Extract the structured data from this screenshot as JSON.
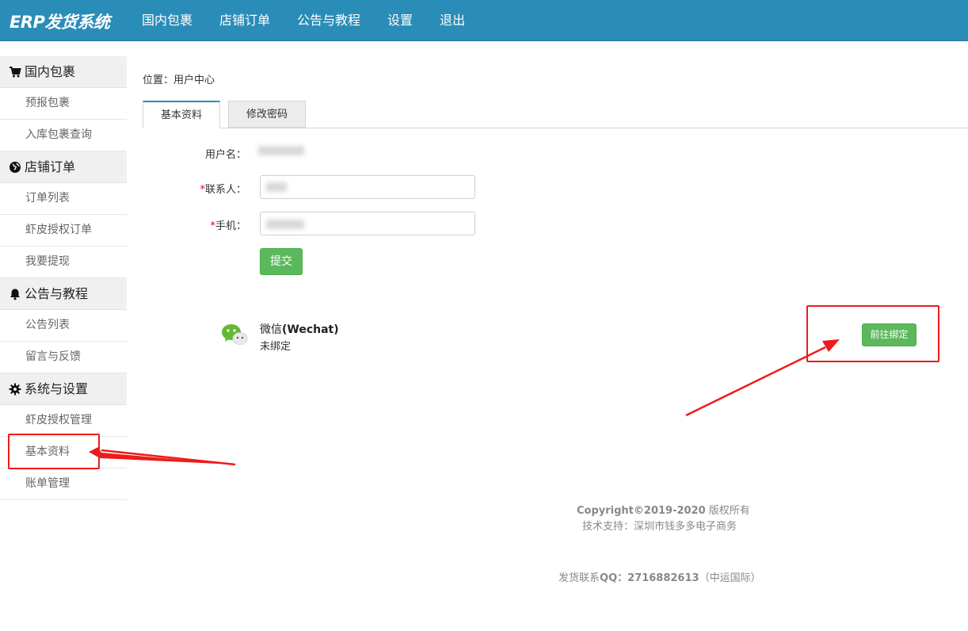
{
  "header": {
    "brand": "ERP发货系统",
    "nav": [
      "国内包裹",
      "店铺订单",
      "公告与教程",
      "设置",
      "退出"
    ]
  },
  "sidebar": {
    "groups": [
      {
        "title": "国内包裹",
        "icon": "cart-icon",
        "items": [
          "预报包裹",
          "入库包裹查询"
        ]
      },
      {
        "title": "店铺订单",
        "icon": "globe-icon",
        "items": [
          "订单列表",
          "虾皮授权订单",
          "我要提现"
        ]
      },
      {
        "title": "公告与教程",
        "icon": "bell-icon",
        "items": [
          "公告列表",
          "留言与反馈"
        ]
      },
      {
        "title": "系统与设置",
        "icon": "gear-icon",
        "items": [
          "虾皮授权管理",
          "基本资料",
          "账单管理"
        ]
      }
    ]
  },
  "breadcrumb": "位置：用户中心",
  "tabs": [
    "基本资料",
    "修改密码"
  ],
  "form": {
    "username_label": "用户名：",
    "contact_label": "联系人：",
    "phone_label": "手机：",
    "required_mark": "*",
    "submit_label": "提交"
  },
  "wechat": {
    "icon": "wechat-icon",
    "title_prefix": "微信",
    "title_bold": "(Wechat)",
    "status": "未绑定",
    "bind_label": "前往绑定"
  },
  "footer": {
    "copyright": "Copyright©2019-2020",
    "rights": " 版权所有",
    "support": "技术支持：深圳市钱多多电子商务",
    "contact_prefix": "发货联系",
    "contact_qq_label": "QQ：2716882613",
    "contact_suffix": "（中运国际）"
  },
  "colors": {
    "header_bg": "#2a8db8",
    "button_green": "#5cb85c",
    "annotation_red": "#ee1b1b"
  }
}
